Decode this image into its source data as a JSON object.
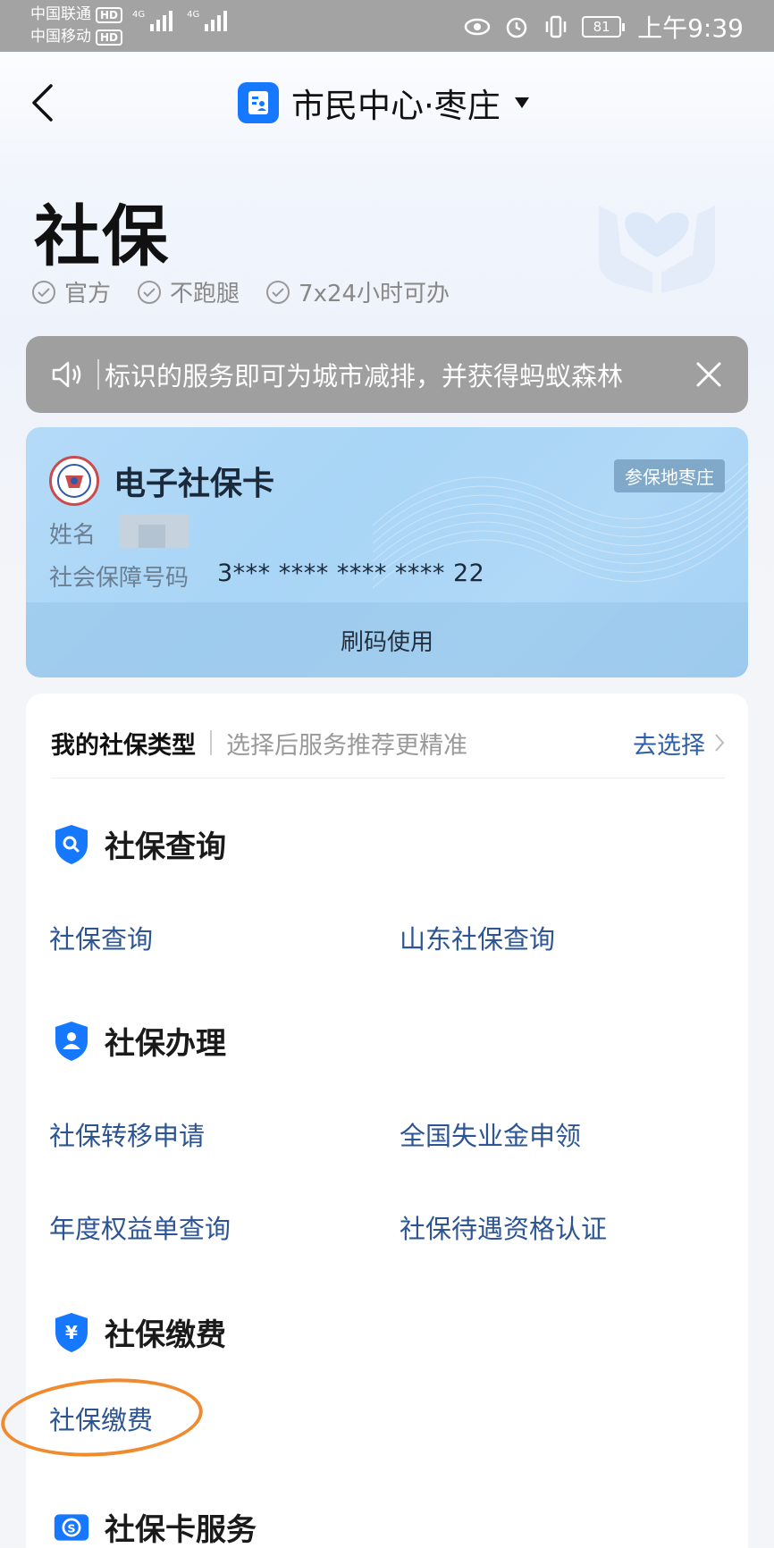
{
  "status_bar": {
    "carrier1": "中国联通",
    "carrier2": "中国移动",
    "hd": "HD",
    "net1": "4G",
    "net2": "4G",
    "battery": "81",
    "time": "上午9:39"
  },
  "nav": {
    "title": "市民中心·枣庄"
  },
  "header": {
    "title": "社保",
    "badges": [
      "官方",
      "不跑腿",
      "7x24小时可办"
    ]
  },
  "notice": {
    "text": "标识的服务即可为城市减排，并获得蚂蚁森林"
  },
  "ss_card": {
    "title": "电子社保卡",
    "tag": "参保地枣庄",
    "name_label": "姓名",
    "id_label": "社会保障号码",
    "id_value": "3*** **** **** **** 22",
    "footer_button": "刷码使用"
  },
  "type_row": {
    "label": "我的社保类型",
    "hint": "选择后服务推荐更精准",
    "action": "去选择"
  },
  "sections": {
    "query": {
      "title": "社保查询",
      "links": [
        "社保查询",
        "山东社保查询"
      ]
    },
    "handle": {
      "title": "社保办理",
      "links": [
        "社保转移申请",
        "全国失业金申领",
        "年度权益单查询",
        "社保待遇资格认证"
      ]
    },
    "pay": {
      "title": "社保缴费",
      "links": [
        "社保缴费"
      ]
    },
    "card": {
      "title": "社保卡服务"
    }
  },
  "colors": {
    "brand_blue": "#1677ff",
    "link_blue": "#2d5594",
    "highlight_orange": "#f08a2e"
  }
}
